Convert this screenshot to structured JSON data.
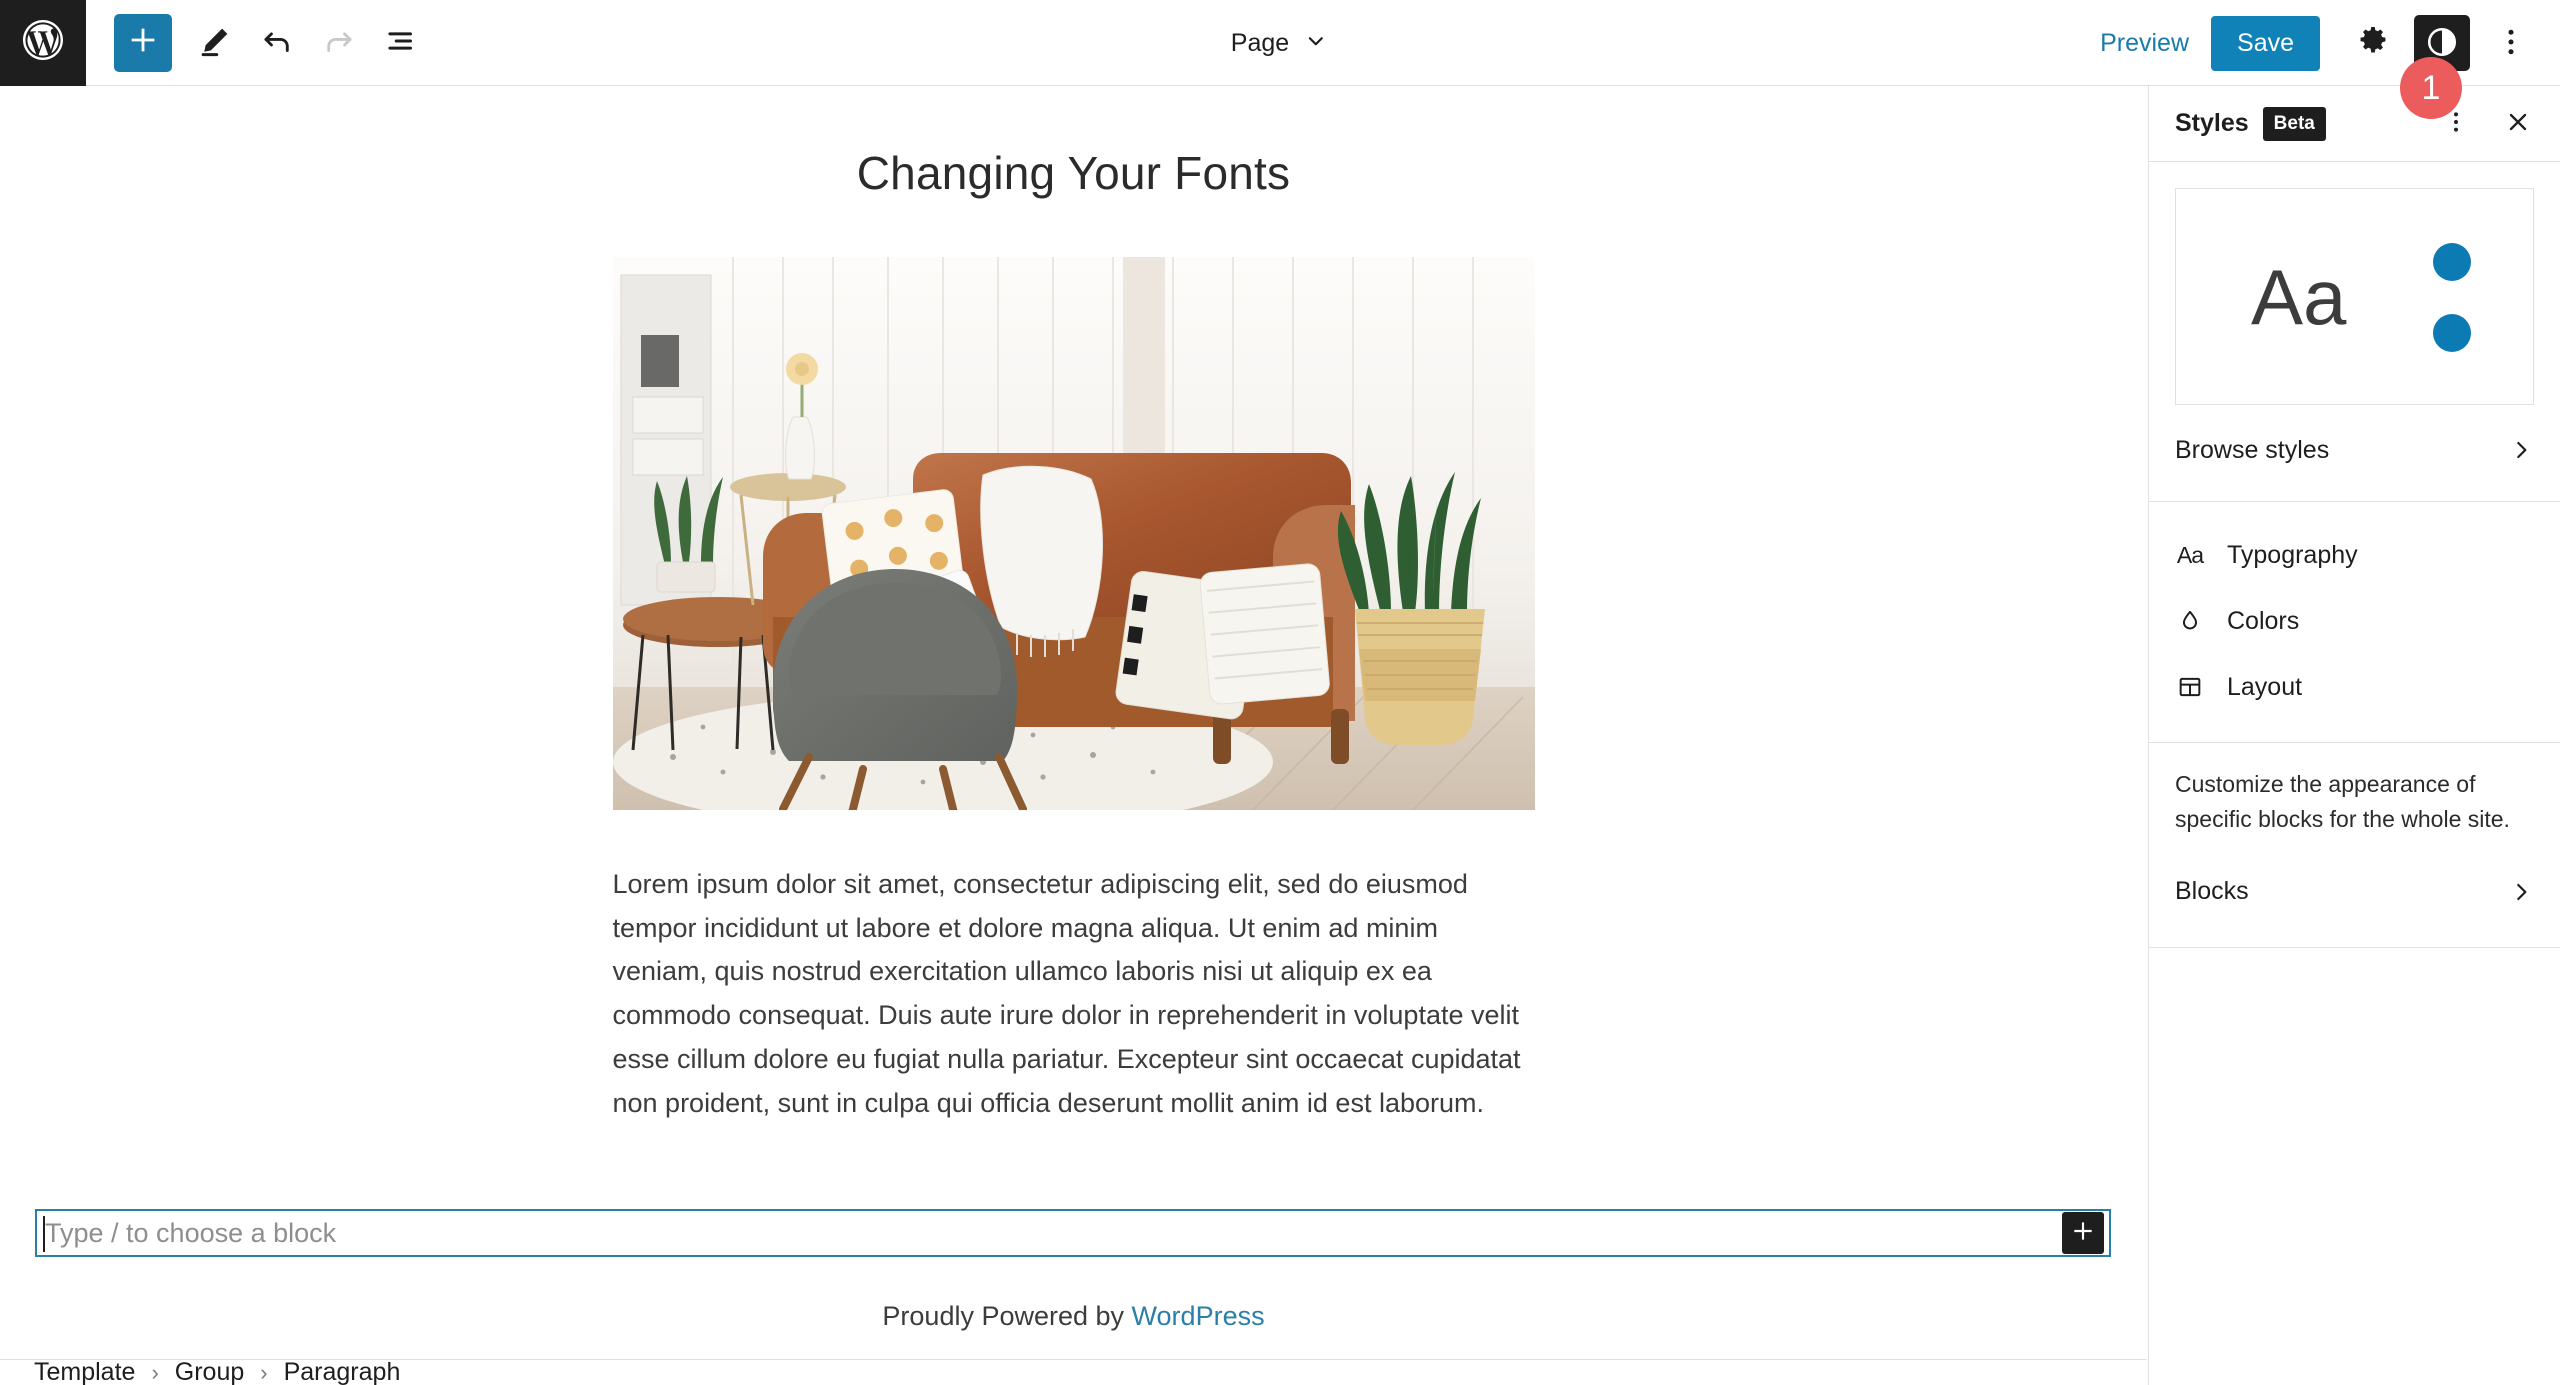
{
  "header": {
    "logo_icon": "wordpress-logo-icon",
    "add_block_label": "+",
    "tools": [
      {
        "name": "add-block-button",
        "icon": "plus-icon"
      },
      {
        "name": "edit-tool-button",
        "icon": "pencil-icon"
      },
      {
        "name": "undo-button",
        "icon": "undo-arrow-icon"
      },
      {
        "name": "redo-button",
        "icon": "redo-arrow-icon"
      },
      {
        "name": "list-view-button",
        "icon": "list-view-icon"
      }
    ],
    "document_title": "Page",
    "preview_label": "Preview",
    "save_label": "Save",
    "settings_icon": "gear-icon",
    "styles_icon": "contrast-half-circle-icon",
    "options_icon": "kebab-menu-icon",
    "notification_badge": "1"
  },
  "canvas": {
    "page_title": "Changing Your Fonts",
    "hero_image_alt": "living-room-with-brown-leather-sofa-gray-chair-and-snake-plant",
    "body_text": "Lorem ipsum dolor sit amet, consectetur adipiscing elit, sed do eiusmod tempor incididunt ut labore et dolore magna aliqua. Ut enim ad minim veniam, quis nostrud exercitation ullamco laboris nisi ut aliquip ex ea commodo consequat. Duis aute irure dolor in reprehenderit in voluptate velit esse cillum dolore eu fugiat nulla pariatur. Excepteur sint occaecat cupidatat non proident, sunt in culpa qui officia deserunt mollit anim id est laborum.",
    "empty_block_placeholder": "Type / to choose a block",
    "appender_label": "+",
    "footer_prefix": "Proudly Powered by ",
    "footer_link": "WordPress"
  },
  "breadcrumb": {
    "items": [
      "Template",
      "Group",
      "Paragraph"
    ],
    "separator": "›"
  },
  "sidebar": {
    "title": "Styles",
    "beta_label": "Beta",
    "more_icon": "kebab-menu-icon",
    "close_icon": "close-x-icon",
    "preview": {
      "sample_text": "Aa",
      "swatch_colors": [
        "#0c7ab3",
        "#0c7ab3"
      ]
    },
    "browse_styles_label": "Browse styles",
    "items": [
      {
        "label": "Typography",
        "icon": "typography-aa-icon"
      },
      {
        "label": "Colors",
        "icon": "color-drop-icon"
      },
      {
        "label": "Layout",
        "icon": "layout-grid-icon"
      }
    ],
    "blocks_description": "Customize the appearance of specific blocks for the whole site.",
    "blocks_label": "Blocks"
  },
  "colors": {
    "accent_blue": "#1182b8",
    "link_blue": "#2a7fa8",
    "badge_red": "#ed5c5c",
    "dark": "#1e1e1e"
  }
}
